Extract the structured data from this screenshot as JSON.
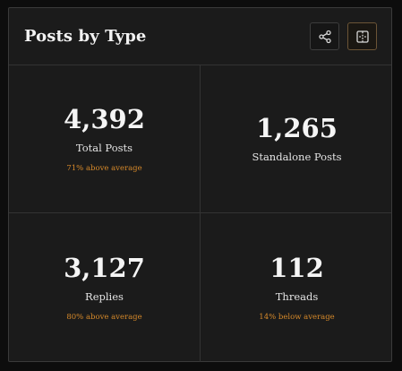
{
  "header": {
    "title": "Posts by Type",
    "share_icon": "share-icon",
    "layout_icon": "split-view-icon"
  },
  "stats": [
    {
      "value": "4,392",
      "label": "Total Posts",
      "note": "71% above average"
    },
    {
      "value": "1,265",
      "label": "Standalone Posts",
      "note": ""
    },
    {
      "value": "3,127",
      "label": "Replies",
      "note": "80% above average"
    },
    {
      "value": "112",
      "label": "Threads",
      "note": "14% below average"
    }
  ],
  "colors": {
    "background": "#1b1b1b",
    "accent": "#d6892a",
    "text": "#f2f2f2"
  }
}
